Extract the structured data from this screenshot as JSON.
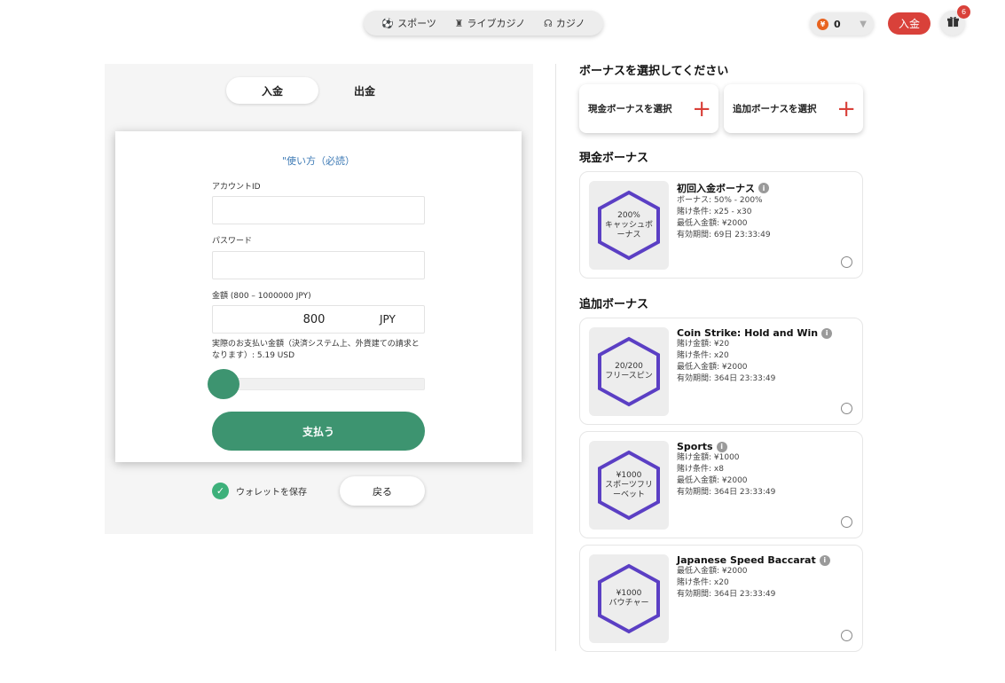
{
  "topnav": {
    "items": [
      {
        "icon": "⚽",
        "label": "スポーツ"
      },
      {
        "icon": "♜",
        "label": "ライブカジノ"
      },
      {
        "icon": "☊",
        "label": "カジノ"
      }
    ]
  },
  "header": {
    "coin_symbol": "¥",
    "balance": "0",
    "deposit_label": "入金",
    "gift_badge": "6"
  },
  "tabs": {
    "deposit": "入金",
    "withdraw": "出金"
  },
  "form": {
    "howto_link": "\"使い方（必読）",
    "account_label": "アカウントID",
    "account_value": "",
    "password_label": "パスワード",
    "password_value": "",
    "amount_label": "金額 (800 – 1000000 JPY)",
    "amount_value": "800",
    "currency": "JPY",
    "pay_info": "実際のお支払い金額（決済システム上、外貨建ての請求となります）:  5.19 USD",
    "slider_fraction": 0.0,
    "pay_button": "支払う"
  },
  "save_wallet_label": "ウォレットを保存",
  "back_button": "戻る",
  "bonus_section": {
    "title": "ボーナスを選択してください",
    "select_cash": "現金ボーナスを選択",
    "select_extra": "追加ボーナスを選択",
    "cash_title": "現金ボーナス",
    "extra_title": "追加ボーナス"
  },
  "cash_bonuses": [
    {
      "badge_lines": [
        "200%",
        "キャッシュボ",
        "ーナス"
      ],
      "name": "初回入金ボーナス",
      "lines": [
        "ボーナス: 50% - 200%",
        "賭け条件: x25 - x30",
        "最低入金額: ¥2000",
        "有効期間: 69日  23:33:49"
      ]
    }
  ],
  "extra_bonuses": [
    {
      "badge_lines": [
        "20/200",
        "フリースピン"
      ],
      "name": "Coin Strike: Hold and Win",
      "lines": [
        "賭け金額: ¥20",
        "賭け条件: x20",
        "最低入金額: ¥2000",
        "有効期間: 364日  23:33:49"
      ]
    },
    {
      "badge_lines": [
        "¥1000",
        "スポーツフリ",
        "ーベット"
      ],
      "name": "Sports",
      "lines": [
        "賭け金額: ¥1000",
        "賭け条件: x8",
        "最低入金額: ¥2000",
        "有効期間: 364日  23:33:49"
      ]
    },
    {
      "badge_lines": [
        "¥1000",
        "バウチャー"
      ],
      "name": "Japanese Speed Baccarat",
      "lines": [
        "最低入金額: ¥2000",
        "賭け条件: x20",
        "有効期間: 364日  23:33:49"
      ]
    }
  ],
  "colors": {
    "accent_green": "#3d9470",
    "accent_red": "#d9413a",
    "hex_purple": "#5b3fc4"
  }
}
